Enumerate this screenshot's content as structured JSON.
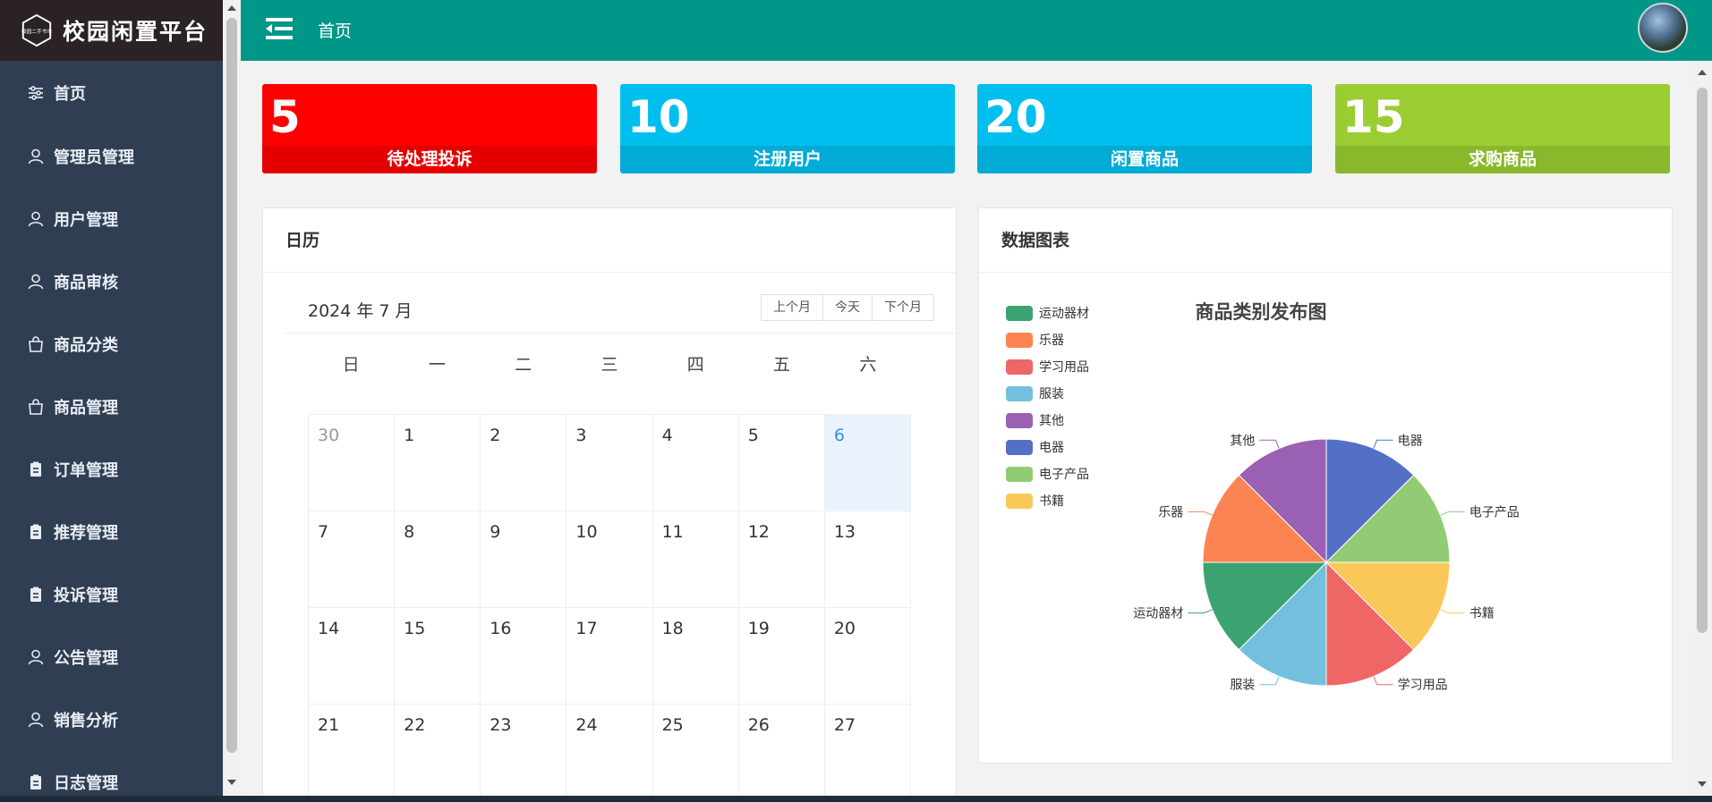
{
  "sidebar": {
    "logo_text": "校园二手书市",
    "title": "校园闲置平台",
    "items": [
      {
        "label": "首页",
        "icon": "sliders-icon"
      },
      {
        "label": "管理员管理",
        "icon": "user-icon"
      },
      {
        "label": "用户管理",
        "icon": "user-icon"
      },
      {
        "label": "商品审核",
        "icon": "user-icon"
      },
      {
        "label": "商品分类",
        "icon": "bag-icon"
      },
      {
        "label": "商品管理",
        "icon": "bag-icon"
      },
      {
        "label": "订单管理",
        "icon": "clipboard-icon"
      },
      {
        "label": "推荐管理",
        "icon": "clipboard-icon"
      },
      {
        "label": "投诉管理",
        "icon": "clipboard-icon"
      },
      {
        "label": "公告管理",
        "icon": "user-icon"
      },
      {
        "label": "销售分析",
        "icon": "user-icon"
      },
      {
        "label": "日志管理",
        "icon": "clipboard-icon"
      }
    ]
  },
  "header": {
    "title": "首页",
    "color": "#009688"
  },
  "stats": [
    {
      "value": "5",
      "label": "待处理投诉",
      "color": "#ff0000"
    },
    {
      "value": "10",
      "label": "注册用户",
      "color": "#00bfef"
    },
    {
      "value": "20",
      "label": "闲置商品",
      "color": "#00bfef"
    },
    {
      "value": "15",
      "label": "求购商品",
      "color": "#9acd32"
    }
  ],
  "calendar": {
    "card_title": "日历",
    "month_label": "2024 年 7 月",
    "buttons": [
      "上个月",
      "今天",
      "下个月"
    ],
    "weekdays": [
      "日",
      "一",
      "二",
      "三",
      "四",
      "五",
      "六"
    ],
    "days": [
      {
        "d": "30",
        "muted": true
      },
      {
        "d": "1"
      },
      {
        "d": "2"
      },
      {
        "d": "3"
      },
      {
        "d": "4"
      },
      {
        "d": "5"
      },
      {
        "d": "6",
        "today": true
      },
      {
        "d": "7"
      },
      {
        "d": "8"
      },
      {
        "d": "9"
      },
      {
        "d": "10"
      },
      {
        "d": "11"
      },
      {
        "d": "12"
      },
      {
        "d": "13"
      },
      {
        "d": "14"
      },
      {
        "d": "15"
      },
      {
        "d": "16"
      },
      {
        "d": "17"
      },
      {
        "d": "18"
      },
      {
        "d": "19"
      },
      {
        "d": "20"
      },
      {
        "d": "21"
      },
      {
        "d": "22"
      },
      {
        "d": "23"
      },
      {
        "d": "24"
      },
      {
        "d": "25"
      },
      {
        "d": "26"
      },
      {
        "d": "27"
      }
    ]
  },
  "chart_card": {
    "card_title": "数据图表"
  },
  "chart_data": {
    "type": "pie",
    "title": "商品类别发布图",
    "legend_position": "top-left",
    "slices": [
      {
        "name": "电器",
        "value": 1,
        "color": "#5470c6"
      },
      {
        "name": "电子产品",
        "value": 1,
        "color": "#91cc75"
      },
      {
        "name": "书籍",
        "value": 1,
        "color": "#fac858"
      },
      {
        "name": "学习用品",
        "value": 1,
        "color": "#ee6666"
      },
      {
        "name": "服装",
        "value": 1,
        "color": "#73c0de"
      },
      {
        "name": "运动器材",
        "value": 1,
        "color": "#3ba272"
      },
      {
        "name": "乐器",
        "value": 1,
        "color": "#fc8452"
      },
      {
        "name": "其他",
        "value": 1,
        "color": "#9a60b4"
      }
    ],
    "legend": [
      "运动器材",
      "乐器",
      "学习用品",
      "服装",
      "其他",
      "电器",
      "电子产品",
      "书籍"
    ]
  }
}
